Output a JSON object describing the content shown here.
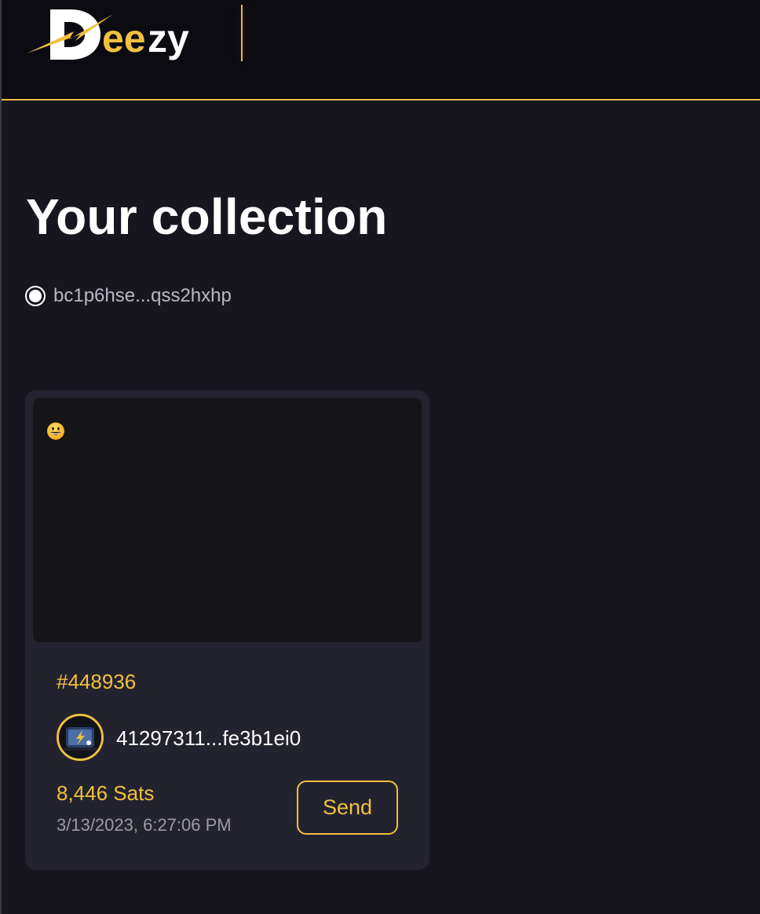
{
  "header": {
    "logo_text": "Deezy"
  },
  "page": {
    "title": "Your collection"
  },
  "wallet": {
    "address": "bc1p6hse...qss2hxhp"
  },
  "collection": {
    "items": [
      {
        "media_emoji": "😃",
        "inscription_number": "#448936",
        "owner_id": "41297311...fe3b1ei0",
        "price": "8,446 Sats",
        "timestamp": "3/13/2023, 6:27:06 PM",
        "send_label": "Send"
      }
    ]
  },
  "colors": {
    "background": "#17161f",
    "header_background": "#0c0b12",
    "accent": "#f0c03f",
    "card_background": "#23232f",
    "media_background": "#151517"
  }
}
